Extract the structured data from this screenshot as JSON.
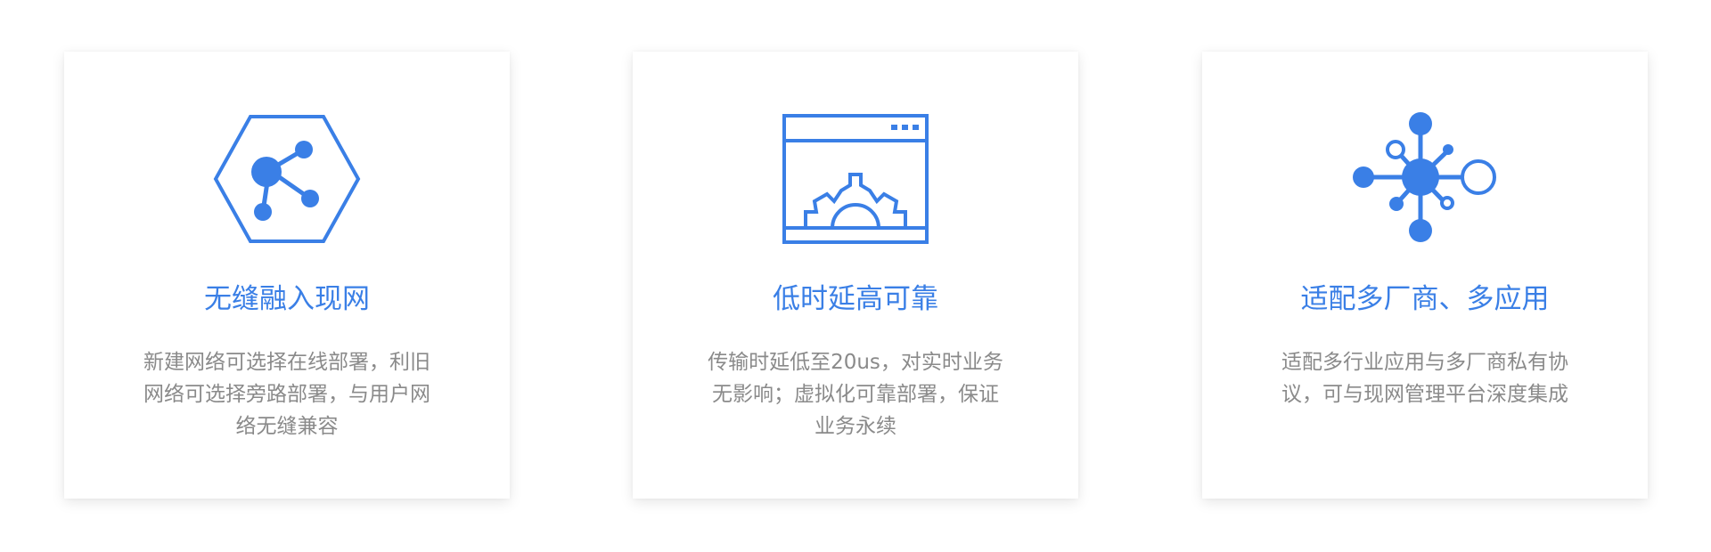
{
  "theme": {
    "accent": "#3a7fe6",
    "text_muted": "#8a8a8a"
  },
  "cards": [
    {
      "icon": "share-hexagon-icon",
      "title": "无缝融入现网",
      "description": "新建网络可选择在线部署，利旧网络可选择旁路部署，与用户网络无缝兼容"
    },
    {
      "icon": "window-gear-icon",
      "title": "低时延高可靠",
      "description": "传输时延低至20us，对实时业务无影响；虚拟化可靠部署，保证业务永续"
    },
    {
      "icon": "hub-network-icon",
      "title": "适配多厂商、多应用",
      "description": "适配多行业应用与多厂商私有协议，可与现网管理平台深度集成"
    }
  ]
}
